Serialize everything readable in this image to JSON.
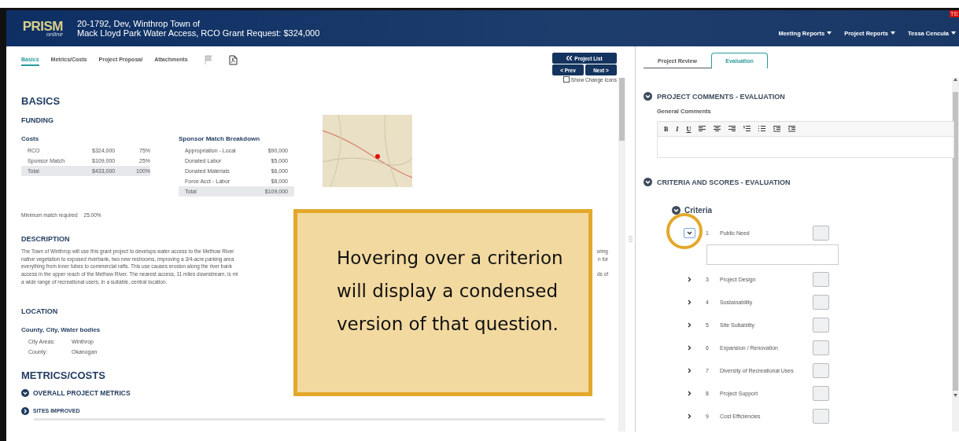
{
  "header": {
    "logo": {
      "title": "PRISM",
      "subtitle": "online"
    },
    "project_id_line": "20-1792, Dev, Winthrop Town of",
    "project_title_line": "Mack Lloyd Park Water Access, RCO Grant Request: $324,000",
    "menus": [
      {
        "label": "Meeting Reports"
      },
      {
        "label": "Project Reports"
      },
      {
        "label": "Tessa Cencula"
      }
    ],
    "alert_badge": "TE"
  },
  "left_panel": {
    "tabs": [
      {
        "label": "Basics",
        "selected": true
      },
      {
        "label": "Metrics/Costs",
        "selected": false
      },
      {
        "label": "Project Proposal",
        "selected": false
      },
      {
        "label": "Attachments",
        "selected": false
      }
    ],
    "nav": {
      "project_list": "Project List",
      "prev": "< Prev",
      "next": "Next >",
      "show_change_icons": {
        "label": "Show Change Icons",
        "checked": false
      }
    },
    "basics": {
      "title": "BASICS",
      "funding_title": "FUNDING",
      "costs": {
        "title": "Costs",
        "rows": [
          {
            "label": "RCO",
            "amount": "$324,000",
            "percent": "75%",
            "total": false
          },
          {
            "label": "Sponsor Match",
            "amount": "$109,000",
            "percent": "25%",
            "total": false
          },
          {
            "label": "Total",
            "amount": "$433,000",
            "percent": "100%",
            "total": true
          }
        ]
      },
      "sponsor_match": {
        "title": "Sponsor Match Breakdown",
        "rows": [
          {
            "label": "Appropriation - Local",
            "amount": "$90,000",
            "total": false
          },
          {
            "label": "Donated Labor",
            "amount": "$5,000",
            "total": false
          },
          {
            "label": "Donated Materials",
            "amount": "$6,000",
            "total": false
          },
          {
            "label": "Force Acct - Labor",
            "amount": "$8,000",
            "total": false
          },
          {
            "label": "Total",
            "amount": "$109,000",
            "total": true
          }
        ]
      },
      "minimum_match": {
        "label": "Minimum match required",
        "value": "25.00%"
      }
    },
    "description": {
      "title": "DESCRIPTION",
      "lines": [
        {
          "start": "The Town of Winthrop will use this grant project to develops water access to the Methow River",
          "end": "oring"
        },
        {
          "start": "native vegetation to exposed riverbank, two new restrooms,  improving a 3/4-acre parking area",
          "end": "n for"
        },
        {
          "start": "everything from inner tubes to commercial rafts.  This use causes erosion along the river bank"
        },
        {
          "start": "access in the upper reach of the Methow River.  The nearest access, 11 miles downstream, is mi",
          "end": "ds of"
        },
        {
          "start": "a wide range of recreational users, in a suitable, central location."
        }
      ]
    },
    "location": {
      "title": "LOCATION",
      "subtitle": "County, City, Water bodies",
      "rows": [
        {
          "label": "City Areas:",
          "value": "Winthrop"
        },
        {
          "label": "County:",
          "value": "Okanogan"
        }
      ]
    },
    "metrics_costs": {
      "title": "METRICS/COSTS",
      "overall": {
        "label": "OVERALL PROJECT METRICS",
        "expanded": true
      },
      "sites_improved": {
        "label": "SITES IMPROVED",
        "expanded": false
      }
    }
  },
  "right_panel": {
    "tabs": [
      {
        "label": "Project Review",
        "selected": false
      },
      {
        "label": "Evaluation",
        "selected": true
      }
    ],
    "comments": {
      "title": "PROJECT COMMENTS - EVALUATION",
      "label": "General Comments",
      "format_buttons": [
        {
          "label": "B",
          "kind": "bold"
        },
        {
          "label": "I",
          "kind": "italic"
        },
        {
          "label": "U",
          "kind": "underline"
        }
      ]
    },
    "criteria_section": {
      "title": "CRITERIA AND SCORES - EVALUATION",
      "group": "Criteria",
      "items": [
        {
          "number": "1",
          "label": "Public Need",
          "expanded": true,
          "highlighted": true
        },
        {
          "number": "3",
          "label": "Project Design",
          "expanded": false,
          "highlighted": false
        },
        {
          "number": "4",
          "label": "Sustainability",
          "expanded": false,
          "highlighted": false
        },
        {
          "number": "5",
          "label": "Site Suitability",
          "expanded": false,
          "highlighted": false
        },
        {
          "number": "6",
          "label": "Expansion / Renovation",
          "expanded": false,
          "highlighted": false
        },
        {
          "number": "7",
          "label": "Diversity of Recreational Uses",
          "expanded": false,
          "highlighted": false
        },
        {
          "number": "8",
          "label": "Project Support",
          "expanded": false,
          "highlighted": false
        },
        {
          "number": "9",
          "label": "Cost Efficiencies",
          "expanded": false,
          "highlighted": false
        }
      ]
    }
  },
  "callout": {
    "text": "Hovering over a criterion will display a condensed version of that question."
  }
}
